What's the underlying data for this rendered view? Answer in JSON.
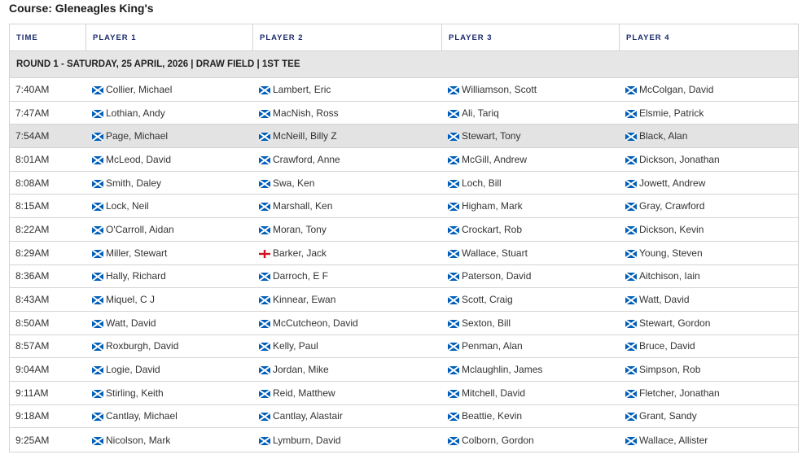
{
  "course_title": "Course: Gleneagles King's",
  "headers": [
    "TIME",
    "PLAYER 1",
    "PLAYER 2",
    "PLAYER 3",
    "PLAYER 4"
  ],
  "round_label": "ROUND 1 - SATURDAY, 25 APRIL, 2026 | DRAW FIELD | 1ST TEE",
  "flags": {
    "scotland": "scotland-flag-icon",
    "england": "england-flag-icon"
  },
  "colors": {
    "header_text": "#1b2a6b",
    "scotland_blue": "#005eb8",
    "england_red": "#cf1020",
    "highlight_row": "#e3e3e3"
  },
  "rows": [
    {
      "time": "7:40AM",
      "players": [
        {
          "name": "Collier, Michael",
          "flag": "scotland"
        },
        {
          "name": "Lambert, Eric",
          "flag": "scotland"
        },
        {
          "name": "Williamson, Scott",
          "flag": "scotland"
        },
        {
          "name": "McColgan, David",
          "flag": "scotland"
        }
      ]
    },
    {
      "time": "7:47AM",
      "players": [
        {
          "name": "Lothian, Andy",
          "flag": "scotland"
        },
        {
          "name": "MacNish, Ross",
          "flag": "scotland"
        },
        {
          "name": "Ali, Tariq",
          "flag": "scotland"
        },
        {
          "name": "Elsmie, Patrick",
          "flag": "scotland"
        }
      ]
    },
    {
      "time": "7:54AM",
      "highlight": true,
      "players": [
        {
          "name": "Page, Michael",
          "flag": "scotland"
        },
        {
          "name": "McNeill, Billy Z",
          "flag": "scotland"
        },
        {
          "name": "Stewart, Tony",
          "flag": "scotland"
        },
        {
          "name": "Black, Alan",
          "flag": "scotland"
        }
      ]
    },
    {
      "time": "8:01AM",
      "players": [
        {
          "name": "McLeod, David",
          "flag": "scotland"
        },
        {
          "name": "Crawford, Anne",
          "flag": "scotland"
        },
        {
          "name": "McGill, Andrew",
          "flag": "scotland"
        },
        {
          "name": "Dickson, Jonathan",
          "flag": "scotland"
        }
      ]
    },
    {
      "time": "8:08AM",
      "players": [
        {
          "name": "Smith, Daley",
          "flag": "scotland"
        },
        {
          "name": "Swa, Ken",
          "flag": "scotland"
        },
        {
          "name": "Loch, Bill",
          "flag": "scotland"
        },
        {
          "name": "Jowett, Andrew",
          "flag": "scotland"
        }
      ]
    },
    {
      "time": "8:15AM",
      "players": [
        {
          "name": "Lock, Neil",
          "flag": "scotland"
        },
        {
          "name": "Marshall, Ken",
          "flag": "scotland"
        },
        {
          "name": "Higham, Mark",
          "flag": "scotland"
        },
        {
          "name": "Gray, Crawford",
          "flag": "scotland"
        }
      ]
    },
    {
      "time": "8:22AM",
      "players": [
        {
          "name": "O'Carroll, Aidan",
          "flag": "scotland"
        },
        {
          "name": "Moran, Tony",
          "flag": "scotland"
        },
        {
          "name": "Crockart, Rob",
          "flag": "scotland"
        },
        {
          "name": "Dickson, Kevin",
          "flag": "scotland"
        }
      ]
    },
    {
      "time": "8:29AM",
      "players": [
        {
          "name": "Miller, Stewart",
          "flag": "scotland"
        },
        {
          "name": "Barker, Jack",
          "flag": "england"
        },
        {
          "name": "Wallace, Stuart",
          "flag": "scotland"
        },
        {
          "name": "Young, Steven",
          "flag": "scotland"
        }
      ]
    },
    {
      "time": "8:36AM",
      "players": [
        {
          "name": "Hally, Richard",
          "flag": "scotland"
        },
        {
          "name": "Darroch, E F",
          "flag": "scotland"
        },
        {
          "name": "Paterson, David",
          "flag": "scotland"
        },
        {
          "name": "Aitchison, Iain",
          "flag": "scotland"
        }
      ]
    },
    {
      "time": "8:43AM",
      "players": [
        {
          "name": "Miquel, C J",
          "flag": "scotland"
        },
        {
          "name": "Kinnear, Ewan",
          "flag": "scotland"
        },
        {
          "name": "Scott, Craig",
          "flag": "scotland"
        },
        {
          "name": "Watt, David",
          "flag": "scotland"
        }
      ]
    },
    {
      "time": "8:50AM",
      "players": [
        {
          "name": "Watt, David",
          "flag": "scotland"
        },
        {
          "name": "McCutcheon, David",
          "flag": "scotland"
        },
        {
          "name": "Sexton, Bill",
          "flag": "scotland"
        },
        {
          "name": "Stewart, Gordon",
          "flag": "scotland"
        }
      ]
    },
    {
      "time": "8:57AM",
      "players": [
        {
          "name": "Roxburgh, David",
          "flag": "scotland"
        },
        {
          "name": "Kelly, Paul",
          "flag": "scotland"
        },
        {
          "name": "Penman, Alan",
          "flag": "scotland"
        },
        {
          "name": "Bruce, David",
          "flag": "scotland"
        }
      ]
    },
    {
      "time": "9:04AM",
      "players": [
        {
          "name": "Logie, David",
          "flag": "scotland"
        },
        {
          "name": "Jordan, Mike",
          "flag": "scotland"
        },
        {
          "name": "Mclaughlin, James",
          "flag": "scotland"
        },
        {
          "name": "Simpson, Rob",
          "flag": "scotland"
        }
      ]
    },
    {
      "time": "9:11AM",
      "players": [
        {
          "name": "Stirling, Keith",
          "flag": "scotland"
        },
        {
          "name": "Reid, Matthew",
          "flag": "scotland"
        },
        {
          "name": "Mitchell, David",
          "flag": "scotland"
        },
        {
          "name": "Fletcher, Jonathan",
          "flag": "scotland"
        }
      ]
    },
    {
      "time": "9:18AM",
      "players": [
        {
          "name": "Cantlay, Michael",
          "flag": "scotland"
        },
        {
          "name": "Cantlay, Alastair",
          "flag": "scotland"
        },
        {
          "name": "Beattie, Kevin",
          "flag": "scotland"
        },
        {
          "name": "Grant, Sandy",
          "flag": "scotland"
        }
      ]
    },
    {
      "time": "9:25AM",
      "players": [
        {
          "name": "Nicolson, Mark",
          "flag": "scotland"
        },
        {
          "name": "Lymburn, David",
          "flag": "scotland"
        },
        {
          "name": "Colborn, Gordon",
          "flag": "scotland"
        },
        {
          "name": "Wallace, Allister",
          "flag": "scotland"
        }
      ]
    }
  ]
}
